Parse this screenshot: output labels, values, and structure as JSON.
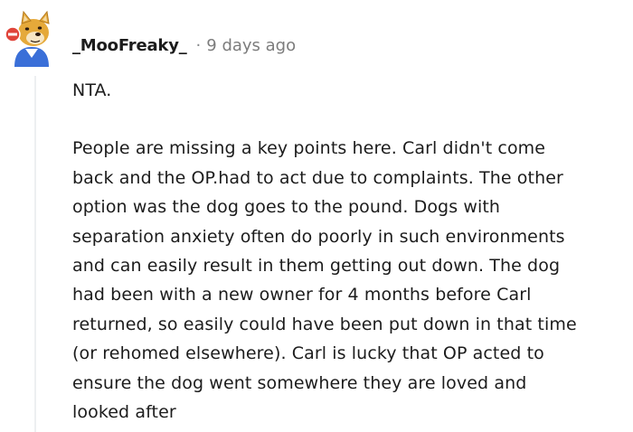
{
  "comment": {
    "avatar": {
      "icon": "doge-snoo-avatar-icon",
      "colors": {
        "fur": "#e5a93a",
        "shirt": "#3a6fd8",
        "badge": "#e0443a"
      }
    },
    "author": "_MooFreaky_",
    "separator": "·",
    "timestamp": "9 days ago",
    "verdict": "NTA.",
    "lines": [
      "People are missing a key points here. Carl didn't come",
      "back and the OP.had to act due to complaints. The other",
      "option was the dog goes to the pound. Dogs with",
      "separation anxiety often do poorly in such environments",
      "and can easily result in them getting out down. The dog",
      "had been with a new owner for 4 months before Carl",
      "returned, so easily could have been put down in that time",
      "(or rehomed elsewhere). Carl is lucky that OP acted to",
      "ensure the dog went somewhere they are loved and",
      "looked after"
    ]
  }
}
